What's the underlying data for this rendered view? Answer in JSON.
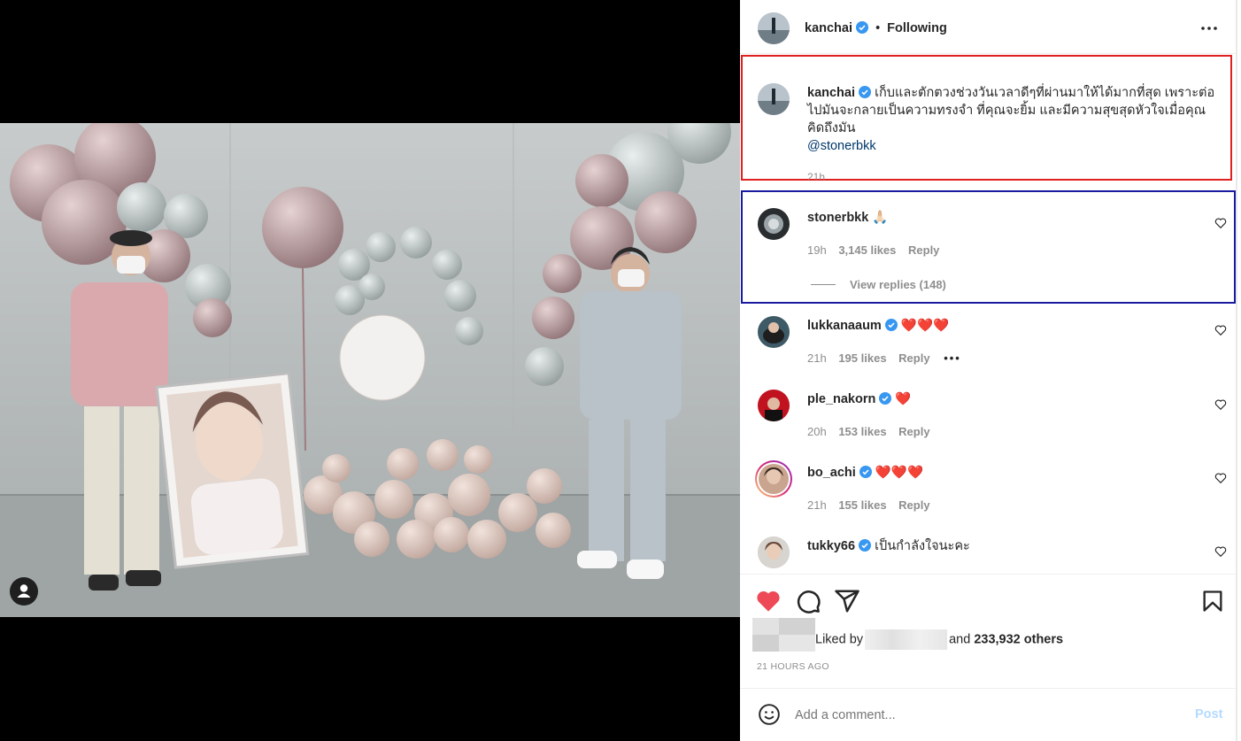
{
  "header": {
    "username": "kanchai",
    "follow_status": "Following",
    "separator": "•"
  },
  "caption": {
    "username": "kanchai",
    "text": "เก็บและตักตวงช่วงวันเวลาดีๆที่ผ่านมาให้ได้มากที่สุด เพราะต่อไปมันจะกลายเป็นความทรงจำ ที่คุณจะยิ้ม และมีความสุขสุดหัวใจเมื่อคุณคิดถึงมัน",
    "mention": "@stonerbkk",
    "time": "21h"
  },
  "comments": [
    {
      "username": "stonerbkk",
      "text": "🙏🏻",
      "time": "19h",
      "likes": "3,145 likes",
      "reply": "Reply",
      "view_replies": "View replies (148)"
    },
    {
      "username": "lukkanaaum",
      "text": "❤️❤️❤️",
      "time": "21h",
      "likes": "195 likes",
      "reply": "Reply"
    },
    {
      "username": "ple_nakorn",
      "text": "❤️",
      "time": "20h",
      "likes": "153 likes",
      "reply": "Reply"
    },
    {
      "username": "bo_achi",
      "text": "❤️❤️❤️",
      "time": "21h",
      "likes": "155 likes",
      "reply": "Reply"
    },
    {
      "username": "tukky66",
      "text": "เป็นกำลังใจนะคะ"
    }
  ],
  "likes": {
    "prefix": "Liked by",
    "and": "and",
    "count": "233,932 others"
  },
  "timestamp": "21 HOURS AGO",
  "add_comment": {
    "placeholder": "Add a comment...",
    "post": "Post"
  },
  "colors": {
    "verified": "#3897f0",
    "like_red": "#ed4956",
    "link_blue": "#00376b",
    "red_box": "#e02020",
    "blue_box": "#1a1aa0"
  }
}
